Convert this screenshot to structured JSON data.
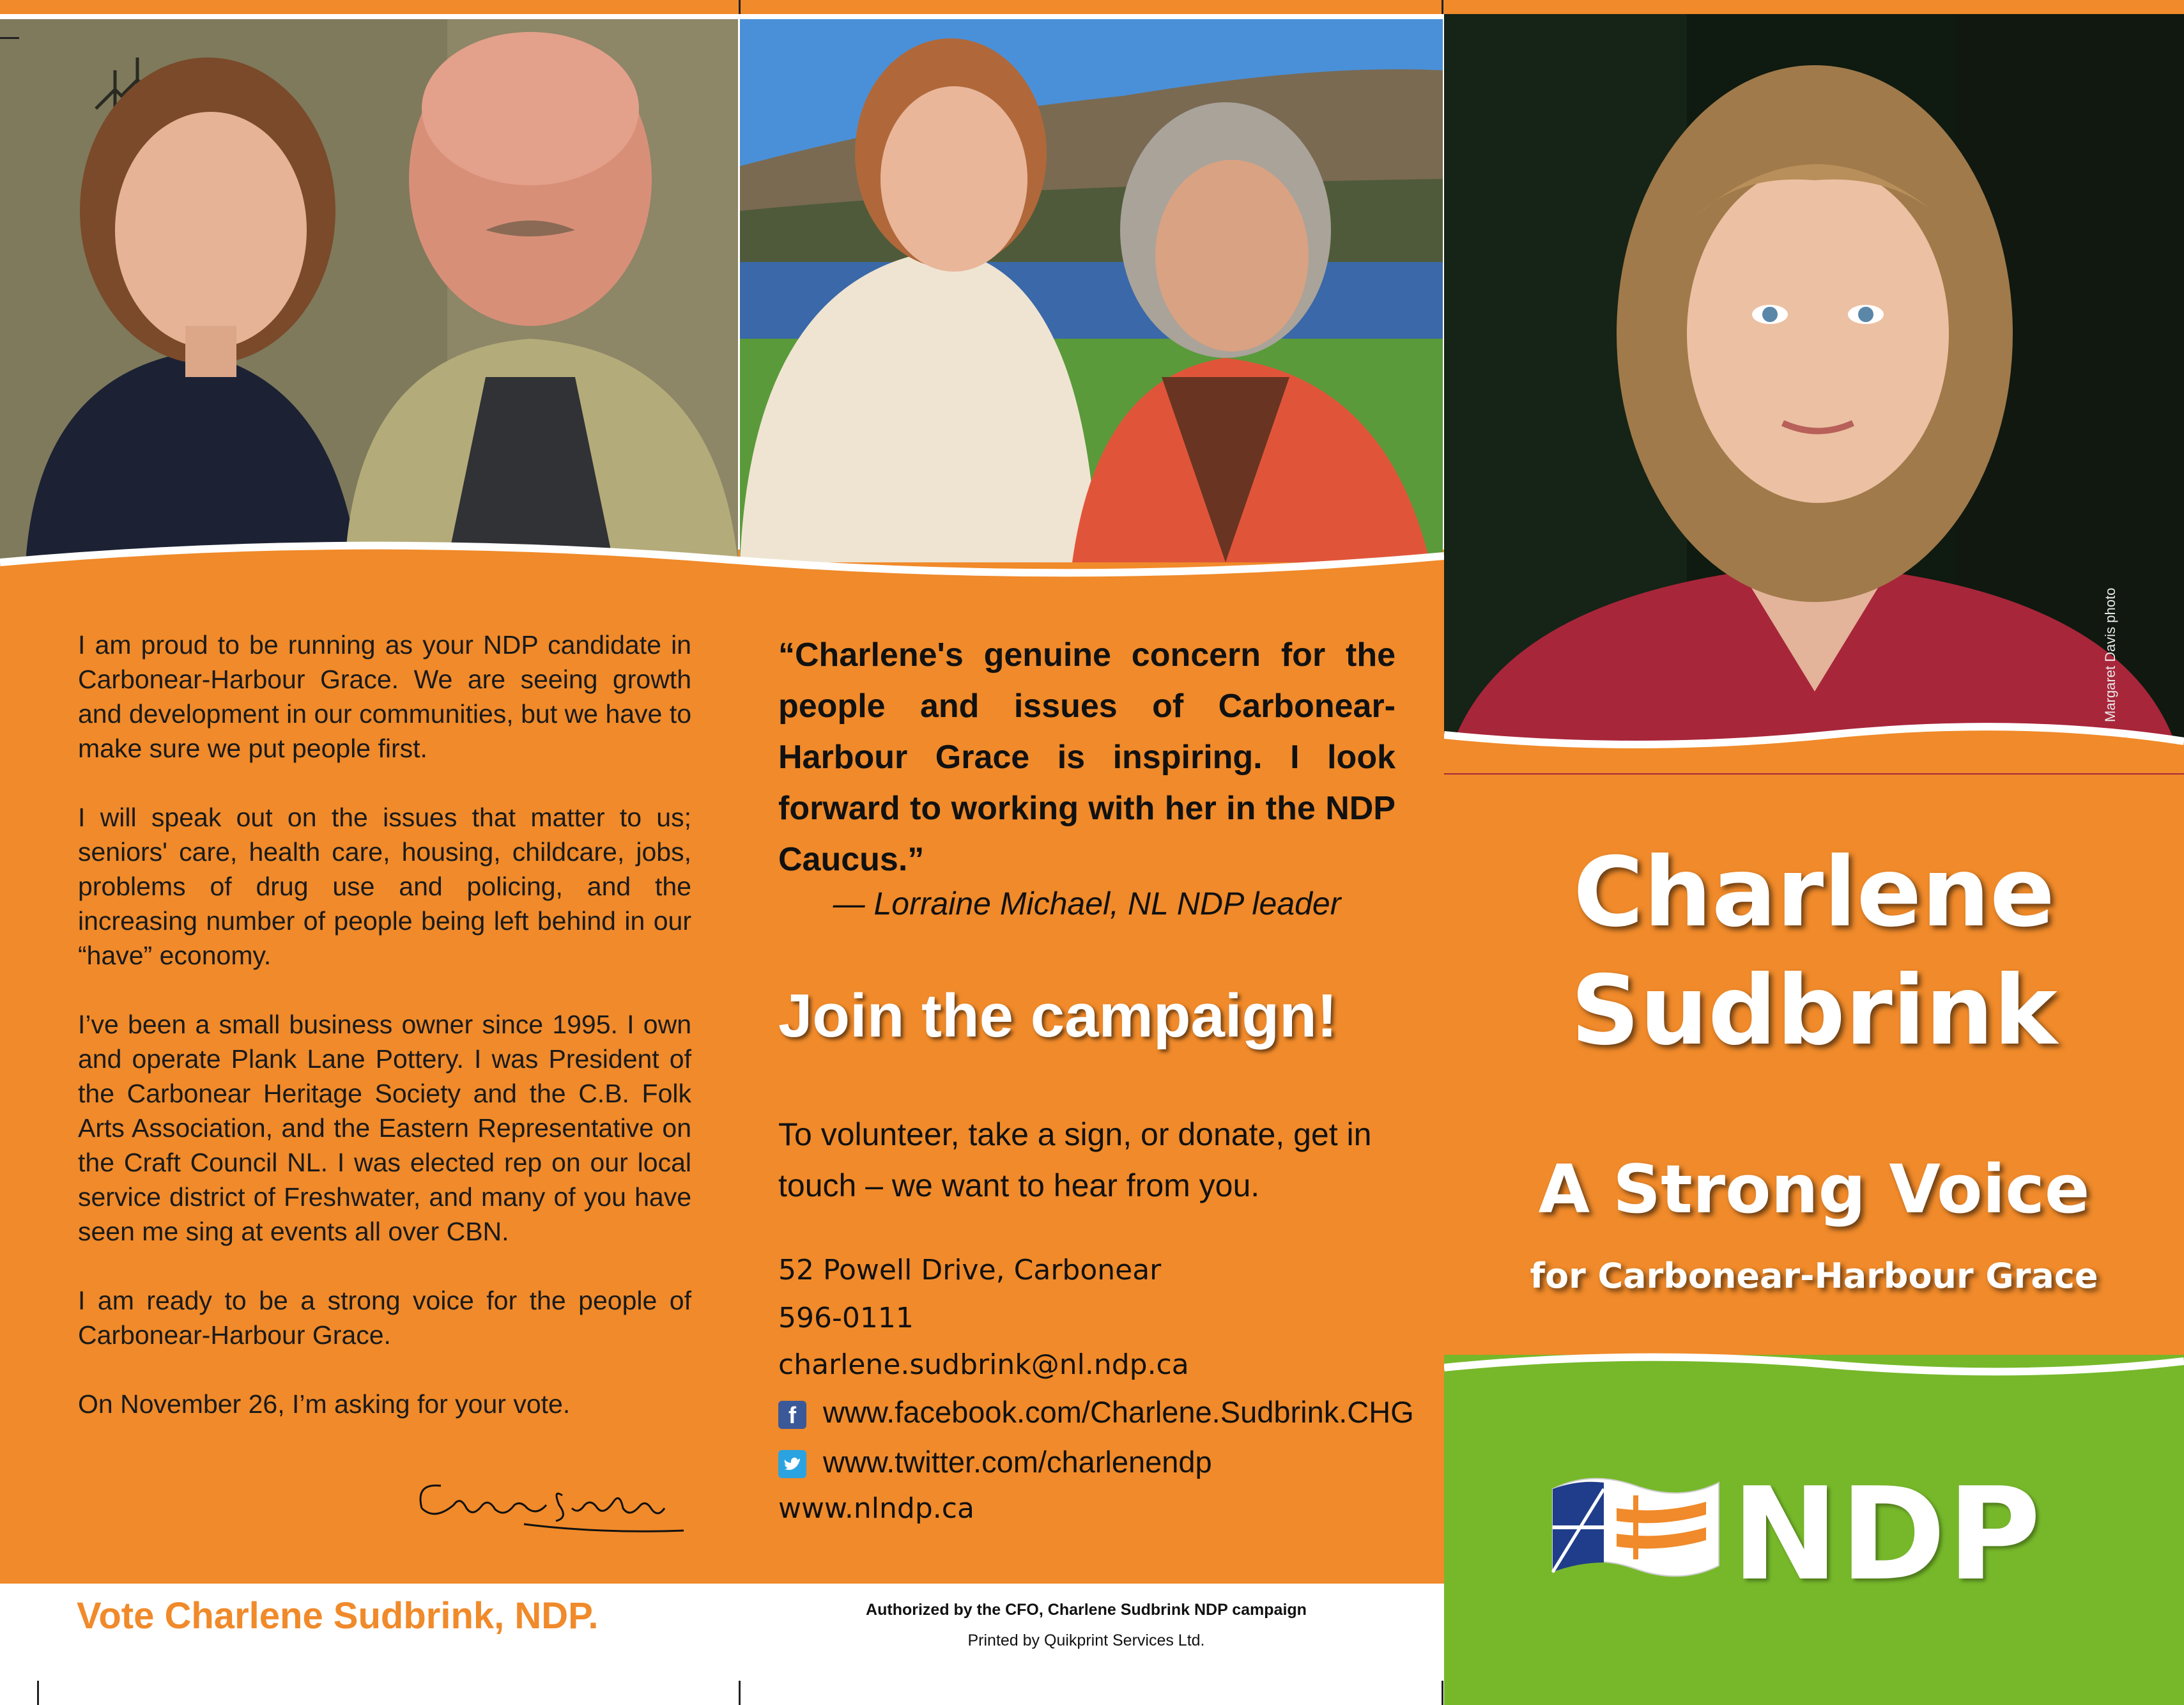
{
  "left_panel": {
    "paragraphs": [
      "I am proud to be running as your NDP candidate in Carbonear-Harbour Grace. We are seeing growth and development in our communities, but we have to make sure we put people first.",
      "I will speak out on the issues that matter to us; seniors' care, health care, housing, childcare, jobs, problems of drug use and policing, and the increasing number of people being left behind in our “have” economy.",
      "I’ve been a small business owner since 1995. I own and operate Plank Lane Pottery. I was President of the Carbonear Heritage Society and the C.B. Folk Arts Association, and the Eastern Representative on the Craft Council NL. I was elected rep on our local service district of Freshwater, and many of you have seen me sing at events all over CBN.",
      "I am ready to be a strong voice for the people of Carbonear-Harbour Grace.",
      "On November 26, I’m asking for your vote."
    ],
    "signature": "Charlene Sudbrink",
    "footer_vote": "Vote Charlene Sudbrink, NDP."
  },
  "middle_panel": {
    "quote": "“Charlene's genuine concern for the people and issues of Carbonear-Harbour Grace is inspiring. I look forward to working with her in the NDP Caucus.”",
    "quote_attribution": "— Lorraine Michael, NL NDP leader",
    "join_heading": "Join the campaign!",
    "volunteer_text": "To volunteer, take a sign, or donate, get in touch – we want to hear from you.",
    "address": "52 Powell Drive, Carbonear",
    "phone": "596-0111",
    "email": "charlene.sudbrink@nl.ndp.ca",
    "facebook": "www.facebook.com/Charlene.Sudbrink.CHG",
    "twitter": "www.twitter.com/charlenendp",
    "website": "www.nlndp.ca",
    "authorized": "Authorized by the CFO, Charlene Sudbrink NDP campaign",
    "printed": "Printed by Quikprint Services Ltd."
  },
  "right_panel": {
    "photo_credit": "Margaret Davis photo",
    "first_name": "Charlene",
    "last_name": "Sudbrink",
    "tagline": "A Strong Voice",
    "sub_tagline": "for Carbonear-Harbour Grace",
    "party": "NDP"
  },
  "icons": {
    "facebook": "facebook-icon",
    "twitter": "twitter-icon",
    "flag": "nl-flag-icon"
  },
  "colors": {
    "orange": "#f08a2a",
    "green": "#76b82a",
    "white": "#ffffff"
  }
}
